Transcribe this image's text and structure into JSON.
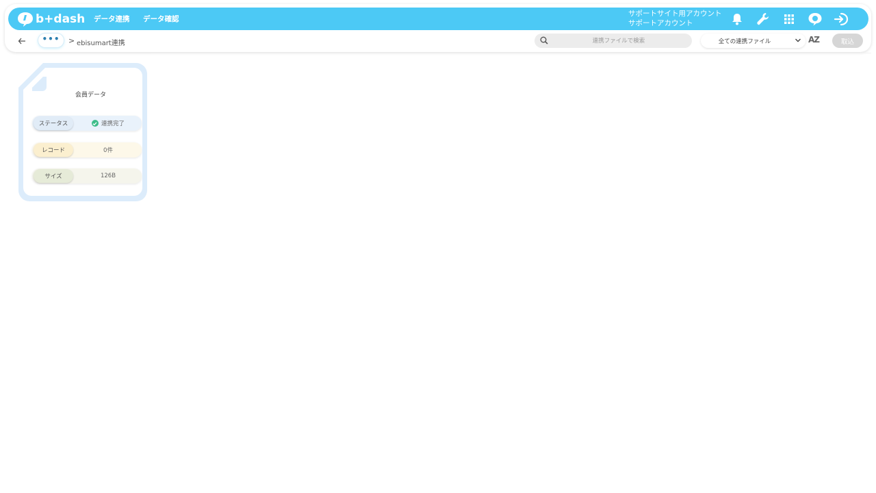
{
  "header": {
    "brand": "b+dash",
    "nav": [
      "データ連携",
      "データ確認"
    ],
    "account": {
      "line1": "サポートサイト用アカウント",
      "line2": "サポートアカウント"
    },
    "icons": [
      "bell-icon",
      "wrench-icon",
      "grid-icon",
      "chat-icon",
      "logout-icon"
    ],
    "accent_color": "#4cc9f5"
  },
  "toolbar": {
    "back_icon": "arrow-left-icon",
    "ellipsis": "•••",
    "breadcrumb_sep": ">",
    "breadcrumb": "ebisumart連携",
    "search_placeholder": "連携ファイルで検索",
    "filter_selected": "全ての連携ファイル",
    "sort_label": "AZ",
    "import_label": "取込"
  },
  "card": {
    "title": "会員データ",
    "rows": [
      {
        "label": "ステータス",
        "value": "連携完了"
      },
      {
        "label": "レコード",
        "value": "0件"
      },
      {
        "label": "サイズ",
        "value": "126B"
      }
    ],
    "status_color": "#3dbd8a"
  }
}
